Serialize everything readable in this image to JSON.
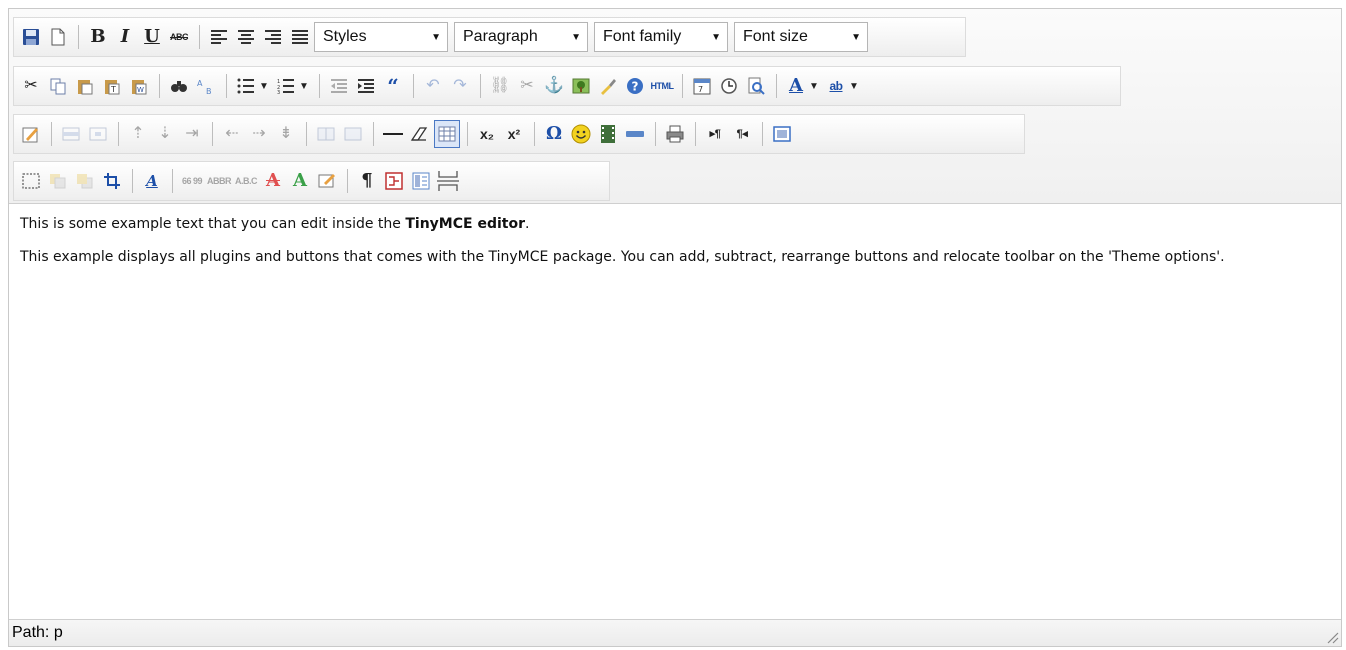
{
  "toolbar": {
    "styles": "Styles",
    "format": "Paragraph",
    "font_family": "Font family",
    "font_size": "Font size",
    "bold": "B",
    "italic": "I",
    "underline": "U",
    "strikethrough": "ABC",
    "subscript": "x₂",
    "superscript": "x²",
    "omega": "Ω",
    "html": "HTML",
    "quote": "66 99",
    "abbr": "ABBR",
    "acronym": "A.B.C",
    "text_color": "A",
    "bg_color": "ab",
    "pilcrow": "¶",
    "ltr": "▸¶",
    "rtl": "¶◂"
  },
  "content": {
    "p1_pre": "This is some example text that you can edit inside the ",
    "p1_bold": "TinyMCE editor",
    "p1_post": ".",
    "p2": "This example displays all plugins and buttons that comes with the TinyMCE package. You can add, subtract, rearrange buttons and relocate toolbar on the 'Theme options'."
  },
  "status": {
    "path_label": "Path:",
    "path_value": "p"
  },
  "colors": {
    "accent": "#1d4fa8",
    "border": "#c9c9c9",
    "toolbar_bg": "#f0f0f0"
  }
}
